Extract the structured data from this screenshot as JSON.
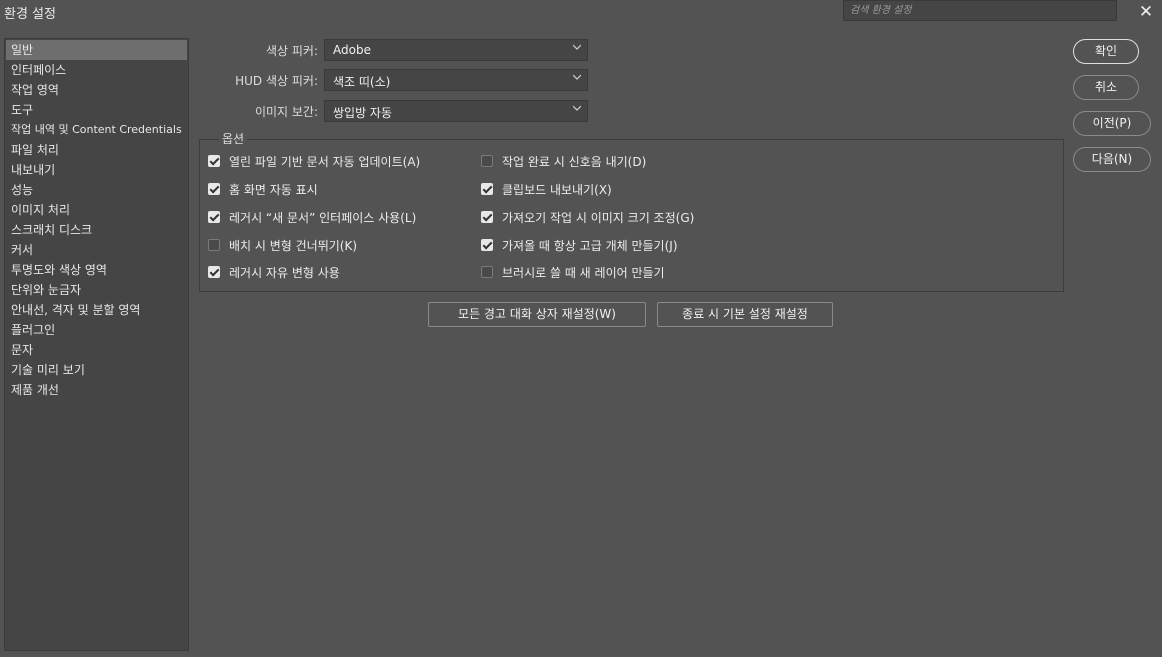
{
  "window": {
    "title": "환경 설정",
    "search_placeholder": "검색 환경 설정",
    "close_glyph": "✕"
  },
  "sidebar": {
    "items": [
      {
        "label": "일반",
        "selected": true
      },
      {
        "label": "인터페이스"
      },
      {
        "label": "작업 영역"
      },
      {
        "label": "도구"
      },
      {
        "label": "작업 내역 및 Content Credentials"
      },
      {
        "label": "파일 처리"
      },
      {
        "label": "내보내기"
      },
      {
        "label": "성능"
      },
      {
        "label": "이미지 처리"
      },
      {
        "label": "스크래치 디스크"
      },
      {
        "label": "커서"
      },
      {
        "label": "투명도와 색상 영역"
      },
      {
        "label": "단위와 눈금자"
      },
      {
        "label": "안내선, 격자 및 분할 영역"
      },
      {
        "label": "플러그인"
      },
      {
        "label": "문자"
      },
      {
        "label": "기술 미리 보기"
      },
      {
        "label": "제품 개선"
      }
    ]
  },
  "general": {
    "color_picker_label": "색상 피커:",
    "color_picker_value": "Adobe",
    "hud_picker_label": "HUD 색상 피커:",
    "hud_picker_value": "색조 띠(소)",
    "interpolation_label": "이미지 보간:",
    "interpolation_value": "쌍입방 자동"
  },
  "options": {
    "legend": "옵션",
    "left": [
      {
        "label": "열린 파일 기반 문서 자동 업데이트(A)",
        "checked": true
      },
      {
        "label": "홈 화면 자동 표시",
        "checked": true
      },
      {
        "label": "레거시 “새 문서” 인터페이스 사용(L)",
        "checked": true
      },
      {
        "label": "배치 시 변형 건너뛰기(K)",
        "checked": false
      },
      {
        "label": "레거시 자유 변형 사용",
        "checked": true
      }
    ],
    "right": [
      {
        "label": "작업 완료 시 신호음 내기(D)",
        "checked": false
      },
      {
        "label": "클립보드 내보내기(X)",
        "checked": true
      },
      {
        "label": "가져오기 작업 시 이미지 크기 조정(G)",
        "checked": true
      },
      {
        "label": "가져올 때 항상 고급 개체 만들기(J)",
        "checked": true
      },
      {
        "label": "브러시로 쓸 때 새 레이어 만들기",
        "checked": false
      }
    ]
  },
  "reset_buttons": {
    "reset_warnings": "모든 경고 대화 상자 재설정(W)",
    "reset_on_quit": "종료 시 기본 설정 재설정"
  },
  "actions": {
    "ok": "확인",
    "cancel": "취소",
    "prev": "이전(P)",
    "next": "다음(N)"
  }
}
